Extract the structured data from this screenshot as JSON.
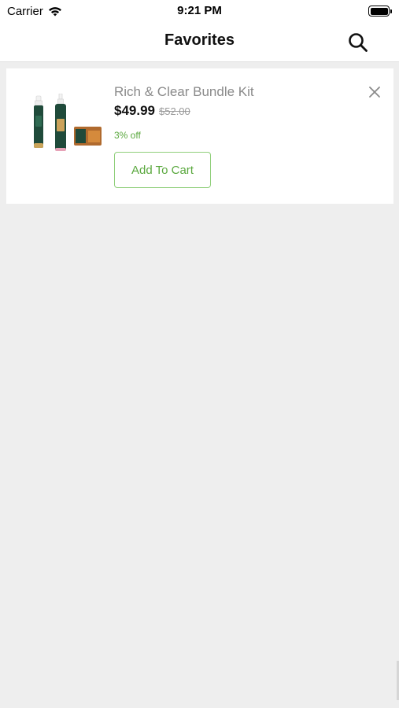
{
  "status_bar": {
    "carrier": "Carrier",
    "time": "9:21 PM",
    "wifi_icon": "wifi-icon",
    "battery_icon": "battery-icon"
  },
  "nav": {
    "title": "Favorites",
    "search_icon": "search-icon"
  },
  "favorites": [
    {
      "name": "Rich & Clear Bundle Kit",
      "price": "$49.99",
      "old_price": "$52.00",
      "discount": "3% off",
      "add_to_cart_label": "Add To Cart",
      "remove_icon": "close-icon"
    }
  ],
  "colors": {
    "accent_green": "#5aa83e",
    "button_border": "#8fcf7a",
    "background": "#eeeeee",
    "product_green": "#1f4a3a"
  }
}
